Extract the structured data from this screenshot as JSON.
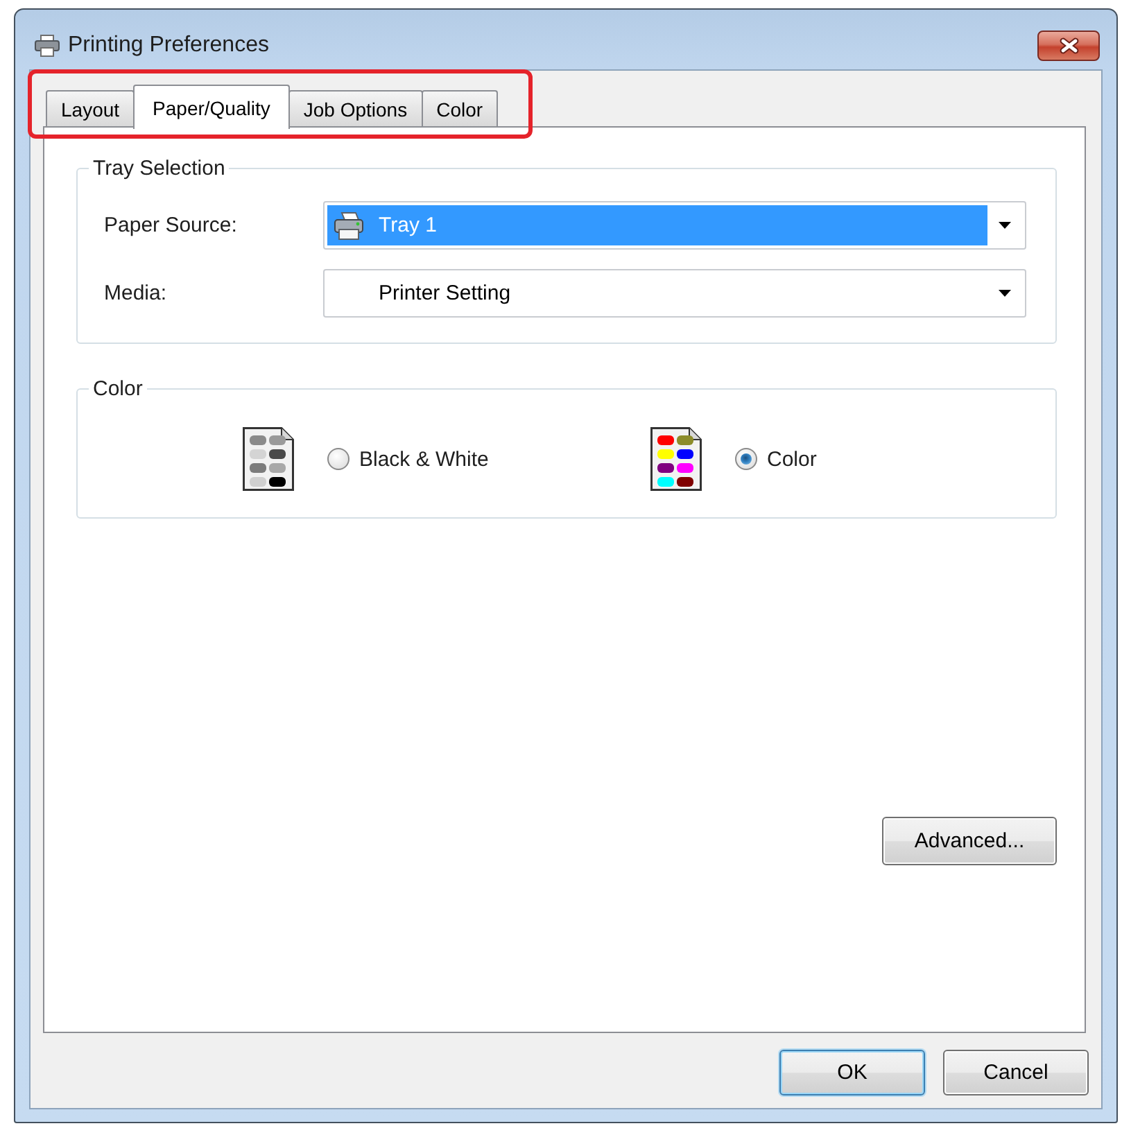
{
  "window": {
    "title": "Printing Preferences"
  },
  "tab_strip": {
    "highlighted": true,
    "tabs": [
      {
        "label": "Layout",
        "selected": false
      },
      {
        "label": "Paper/Quality",
        "selected": true
      },
      {
        "label": "Job Options",
        "selected": false
      },
      {
        "label": "Color",
        "selected": false
      }
    ]
  },
  "tray_selection": {
    "title": "Tray Selection",
    "fields": [
      {
        "label": "Paper Source:",
        "value": "Tray 1",
        "kind": "tray",
        "focused": true
      },
      {
        "label": "Media:",
        "value": "Printer Setting",
        "kind": "media",
        "focused": false
      }
    ]
  },
  "color": {
    "title": "Color",
    "options": [
      {
        "label": "Black & White",
        "kind": "grayscale",
        "selected": false
      },
      {
        "label": "Color",
        "kind": "color",
        "selected": true
      }
    ]
  },
  "advanced_button": "Advanced...",
  "buttons": [
    {
      "label": "OK",
      "focused": true
    },
    {
      "label": "Cancel",
      "focused": false
    }
  ]
}
